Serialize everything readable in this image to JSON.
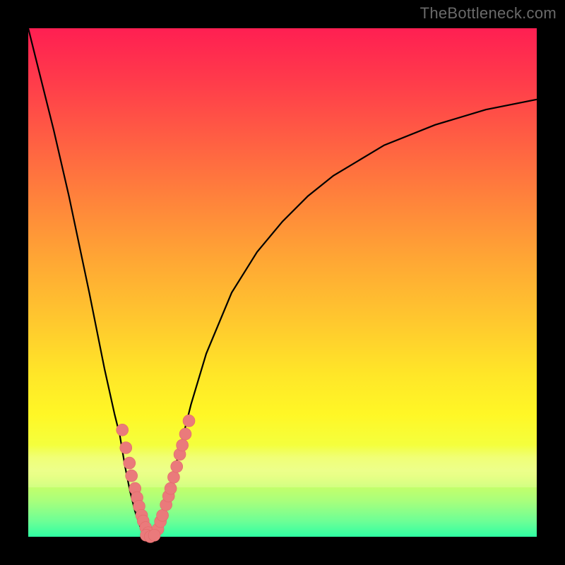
{
  "watermark": "TheBottleneck.com",
  "colors": {
    "background": "#000000",
    "curve_stroke": "#000000",
    "marker_fill": "#ea7a7b",
    "marker_outline": "#e26869"
  },
  "chart_data": {
    "type": "line",
    "title": "",
    "xlabel": "",
    "ylabel": "",
    "xlim": [
      0,
      100
    ],
    "ylim": [
      0,
      100
    ],
    "curve": {
      "description": "V-shaped bottleneck curve; y = 0 at optimum, rising toward 100 away from it",
      "optimum_x": 24,
      "x": [
        0,
        2,
        5,
        8,
        12,
        15,
        17,
        18,
        19,
        20,
        21,
        22,
        23,
        24,
        25,
        26,
        27,
        28,
        29,
        30,
        32,
        35,
        40,
        45,
        50,
        55,
        60,
        70,
        80,
        90,
        100
      ],
      "y": [
        100,
        92,
        80,
        67,
        48,
        33,
        24,
        20,
        14,
        9,
        5,
        2,
        0.6,
        0,
        0.6,
        2,
        5,
        9,
        14,
        18,
        26,
        36,
        48,
        56,
        62,
        67,
        71,
        77,
        81,
        84,
        86
      ]
    },
    "series": [
      {
        "name": "left-arm-markers",
        "x": [
          18.5,
          19.2,
          19.9,
          20.3,
          21.0,
          21.4,
          21.8,
          22.3,
          22.6,
          23.1,
          23.6
        ],
        "y": [
          21.0,
          17.5,
          14.5,
          12.0,
          9.5,
          7.7,
          6.0,
          4.2,
          3.1,
          1.8,
          0.8
        ]
      },
      {
        "name": "right-arm-markers",
        "x": [
          25.5,
          26.0,
          26.4,
          27.1,
          27.6,
          28.0,
          28.6,
          29.2,
          29.8,
          30.3,
          30.9,
          31.6
        ],
        "y": [
          1.5,
          3.0,
          4.2,
          6.3,
          8.0,
          9.5,
          11.7,
          13.8,
          16.2,
          18.0,
          20.2,
          22.8
        ]
      },
      {
        "name": "bottom-markers",
        "x": [
          23.2,
          24.0,
          24.8
        ],
        "y": [
          0.3,
          0.0,
          0.3
        ]
      }
    ]
  }
}
